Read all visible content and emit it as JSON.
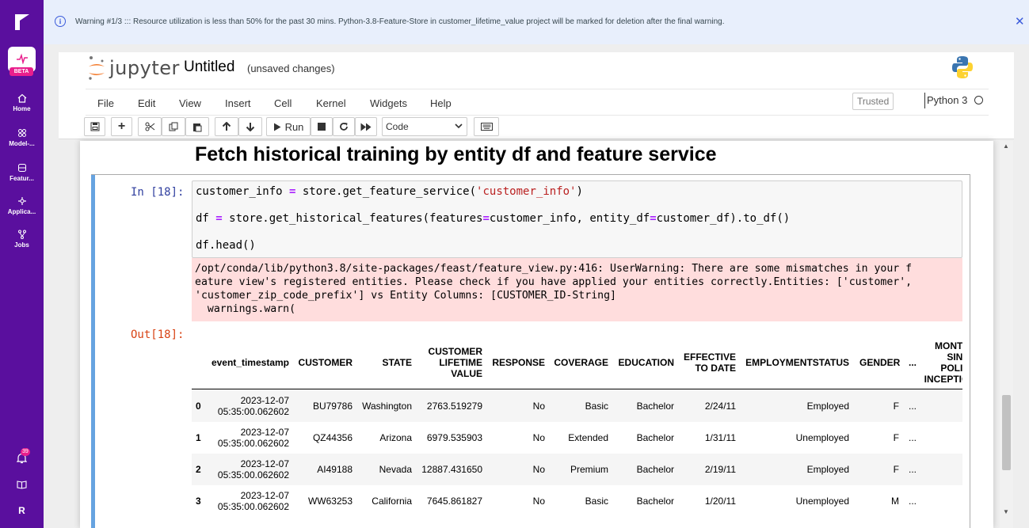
{
  "sidebar": {
    "badge": "BETA",
    "items": [
      {
        "label": "Home",
        "icon": "home-icon"
      },
      {
        "label": "Model-...",
        "icon": "model-icon"
      },
      {
        "label": "Featur...",
        "icon": "feature-store-icon"
      },
      {
        "label": "Applica...",
        "icon": "applications-icon"
      },
      {
        "label": "Jobs",
        "icon": "jobs-icon"
      }
    ],
    "notifications_count": "39",
    "user_initial": "R"
  },
  "banner": {
    "message": "Warning #1/3 ::: Resource utilization is less than 50% for the past 30 mins. Python-3.8-Feature-Store in customer_lifetime_value project will be marked for deletion after the final warning.",
    "close": "✕"
  },
  "jupyter": {
    "wordmark": "jupyter",
    "notebook_title": "Untitled",
    "save_status": "(unsaved changes)",
    "menu": [
      "File",
      "Edit",
      "View",
      "Insert",
      "Cell",
      "Kernel",
      "Widgets",
      "Help"
    ],
    "trusted": "Trusted",
    "kernel": "Python 3",
    "run_label": "Run",
    "cell_type": "Code"
  },
  "notebook": {
    "heading": "Fetch historical training by entity df and feature service",
    "in_prompt": "In [18]:",
    "out_prompt": "Out[18]:",
    "code": [
      "customer_info = store.get_feature_service('customer_info')",
      "df = store.get_historical_features(features=customer_info, entity_df=customer_df).to_df()",
      "df.head()"
    ],
    "stderr": [
      "/opt/conda/lib/python3.8/site-packages/feast/feature_view.py:416: UserWarning: There are some mismatches in your f",
      "eature view's registered entities. Please check if you have applied your entities correctly.Entities: ['customer',",
      "'customer_zip_code_prefix'] vs Entity Columns: [CUSTOMER_ID-String]",
      "  warnings.warn("
    ],
    "dataframe": {
      "columns": [
        "event_timestamp",
        "CUSTOMER",
        "STATE",
        "CUSTOMER\nLIFETIME\nVALUE",
        "RESPONSE",
        "COVERAGE",
        "EDUCATION",
        "EFFECTIVE\nTO DATE",
        "EMPLOYMENTSTATUS",
        "GENDER",
        "...",
        "MONTHS\nSINCE\nPOLICY\nINCEPTION"
      ],
      "rows": [
        {
          "idx": "0",
          "ts1": "2023-12-07",
          "ts2": "05:35:00.062602",
          "customer": "BU79786",
          "state": "Washington",
          "clv": "2763.519279",
          "response": "No",
          "coverage": "Basic",
          "education": "Bachelor",
          "eff": "2/24/11",
          "emp": "Employed",
          "gender": "F",
          "ell": "..."
        },
        {
          "idx": "1",
          "ts1": "2023-12-07",
          "ts2": "05:35:00.062602",
          "customer": "QZ44356",
          "state": "Arizona",
          "clv": "6979.535903",
          "response": "No",
          "coverage": "Extended",
          "education": "Bachelor",
          "eff": "1/31/11",
          "emp": "Unemployed",
          "gender": "F",
          "ell": "..."
        },
        {
          "idx": "2",
          "ts1": "2023-12-07",
          "ts2": "05:35:00.062602",
          "customer": "AI49188",
          "state": "Nevada",
          "clv": "12887.431650",
          "response": "No",
          "coverage": "Premium",
          "education": "Bachelor",
          "eff": "2/19/11",
          "emp": "Employed",
          "gender": "F",
          "ell": "..."
        },
        {
          "idx": "3",
          "ts1": "2023-12-07",
          "ts2": "05:35:00.062602",
          "customer": "WW63253",
          "state": "California",
          "clv": "7645.861827",
          "response": "No",
          "coverage": "Basic",
          "education": "Bachelor",
          "eff": "1/20/11",
          "emp": "Unemployed",
          "gender": "M",
          "ell": "..."
        }
      ]
    }
  },
  "colors": {
    "sidebar": "#5a0f9e",
    "beta_badge": "#e91e8c",
    "banner_bg": "#e8effc",
    "stderr_bg": "#ffdddd",
    "cell_border_active": "#66a3e0"
  }
}
